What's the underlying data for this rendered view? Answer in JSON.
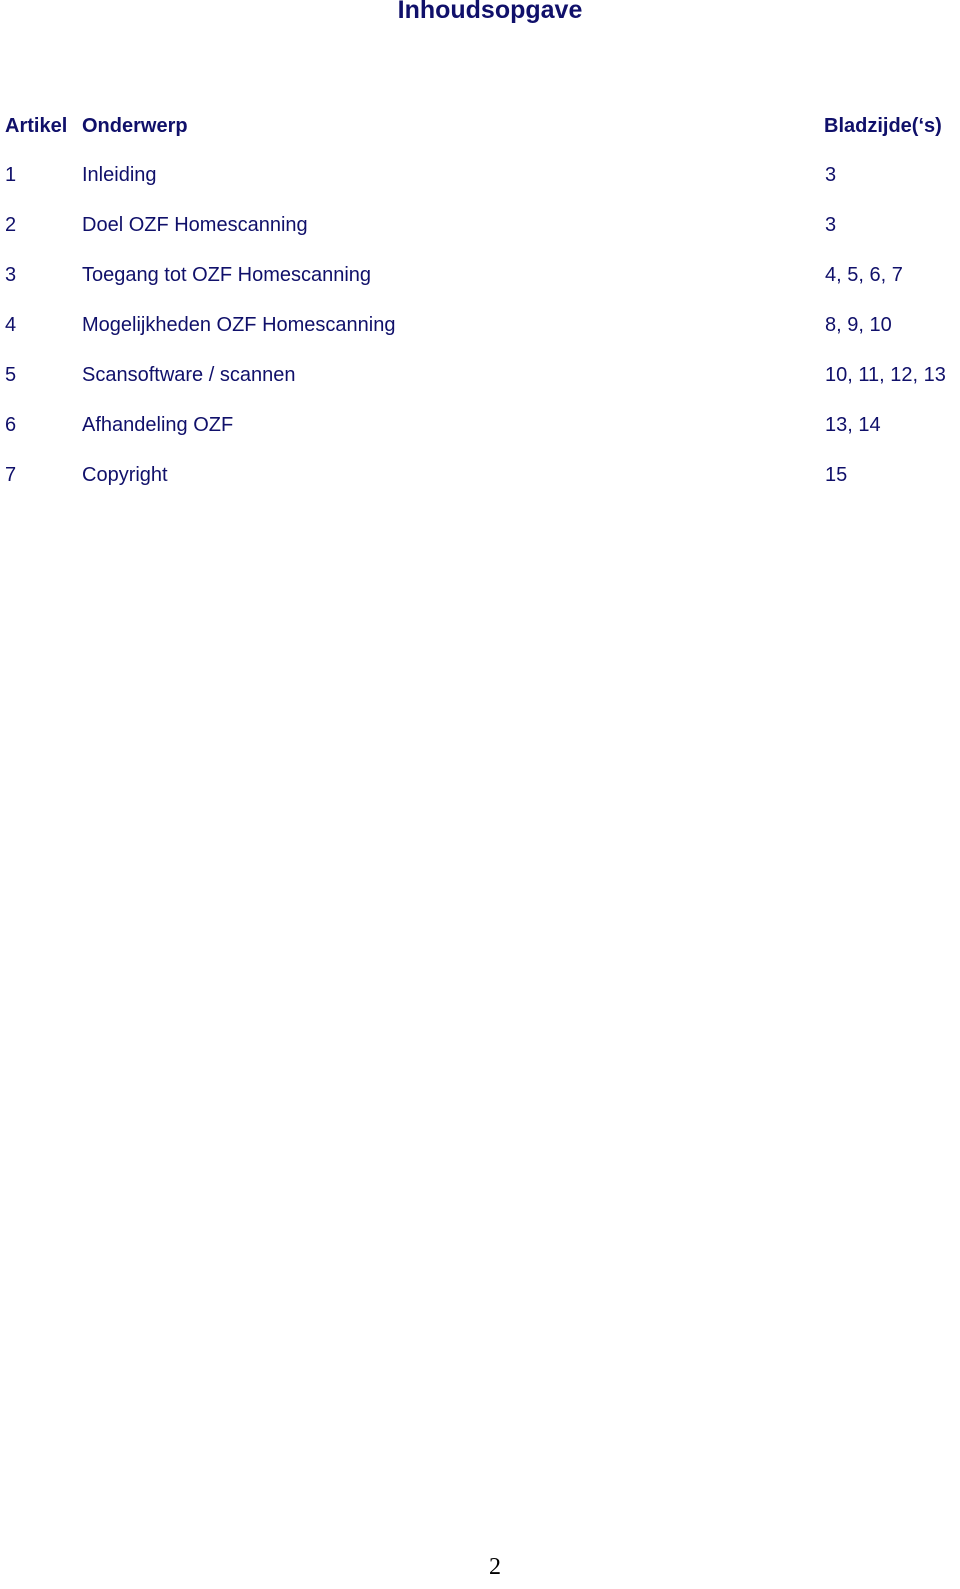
{
  "title": "Inhoudsopgave",
  "headers": {
    "artikel": "Artikel",
    "onderwerp": "Onderwerp",
    "bladzijden": "Bladzijde(‘s)"
  },
  "rows": [
    {
      "artikel": "1",
      "onderwerp": "Inleiding",
      "bladzijden": "3"
    },
    {
      "artikel": "2",
      "onderwerp": "Doel OZF Homescanning",
      "bladzijden": "3"
    },
    {
      "artikel": "3",
      "onderwerp": "Toegang tot OZF Homescanning",
      "bladzijden": "4, 5, 6, 7"
    },
    {
      "artikel": "4",
      "onderwerp": "Mogelijkheden OZF Homescanning",
      "bladzijden": "8, 9, 10"
    },
    {
      "artikel": "5",
      "onderwerp": "Scansoftware / scannen",
      "bladzijden": "10, 11, 12, 13"
    },
    {
      "artikel": "6",
      "onderwerp": "Afhandeling OZF",
      "bladzijden": "13, 14"
    },
    {
      "artikel": "7",
      "onderwerp": "Copyright",
      "bladzijden": "15"
    }
  ],
  "page_number": "2",
  "colors": {
    "text": "#10106a",
    "page_number": "#000000"
  }
}
